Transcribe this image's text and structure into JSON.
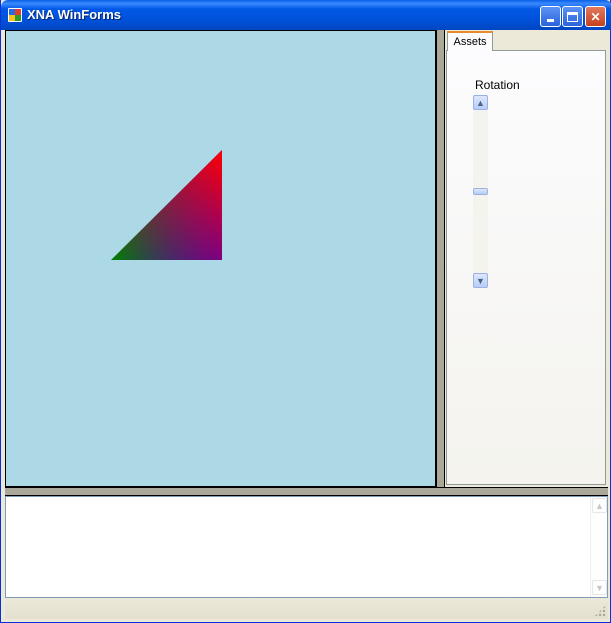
{
  "window": {
    "title": "XNA WinForms"
  },
  "viewport": {
    "background_color": "#add8e6",
    "triangle_colors": [
      "#ff0000",
      "#008000",
      "#0000ff"
    ]
  },
  "tabs": [
    {
      "label": "Assets",
      "selected": true
    }
  ],
  "assets_panel": {
    "rotation_label": "Rotation",
    "rotation_slider": {
      "orientation": "vertical",
      "level_fraction": 0.5
    }
  },
  "output": {
    "text": ""
  },
  "icons": {
    "minimize": "minimize-icon",
    "maximize": "maximize-icon",
    "close": "close-icon",
    "app": "xna-app-icon"
  }
}
